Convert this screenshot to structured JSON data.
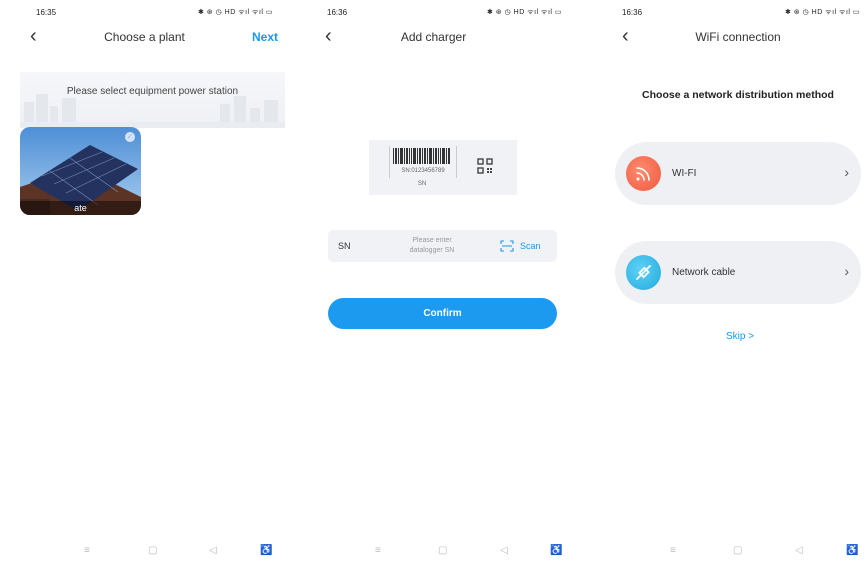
{
  "screen1": {
    "status": {
      "time": "16:35",
      "icons": "✱ ⊛ ◷ HD ᯤıl ᯤıl ▭"
    },
    "nav": {
      "back": "‹",
      "title": "Choose a plant",
      "next": "Next"
    },
    "banner_text": "Please select equipment power station",
    "plant": {
      "name": "ate",
      "check": "✓"
    },
    "sysnav": {
      "menu": "≡",
      "home": "▢",
      "back": "◁",
      "accessibility": "♿"
    }
  },
  "screen2": {
    "status": {
      "time": "16:36",
      "icons": "✱ ⊛ ◷ HD ᯤıl ᯤıl ▭"
    },
    "nav": {
      "back": "‹",
      "title": "Add charger"
    },
    "sample": {
      "code": "SN:0123456789",
      "caption": "SN"
    },
    "sn": {
      "label": "SN",
      "placeholder_line1": "Please enter",
      "placeholder_line2": "datalogger SN",
      "scan": "Scan"
    },
    "confirm": "Confirm",
    "sysnav": {
      "menu": "≡",
      "home": "▢",
      "back": "◁",
      "accessibility": "♿"
    }
  },
  "screen3": {
    "status": {
      "time": "16:36",
      "icons": "✱ ⊛ ◷ HD ᯤıl ᯤıl ▭"
    },
    "nav": {
      "back": "‹",
      "title": "WiFi connection"
    },
    "heading": "Choose a network distribution method",
    "methods": [
      {
        "label": "WI-FI",
        "chevron": "›",
        "icon": "wifi-icon",
        "color": "#f26b4e"
      },
      {
        "label": "Network cable",
        "chevron": "›",
        "icon": "cable-icon",
        "color": "#2fb8e8"
      }
    ],
    "skip": "Skip  >",
    "sysnav": {
      "menu": "≡",
      "home": "▢",
      "back": "◁",
      "accessibility": "♿"
    }
  },
  "colors": {
    "accent": "#1e96e8",
    "button": "#1b9aef",
    "card_bg": "#eef0f3"
  }
}
